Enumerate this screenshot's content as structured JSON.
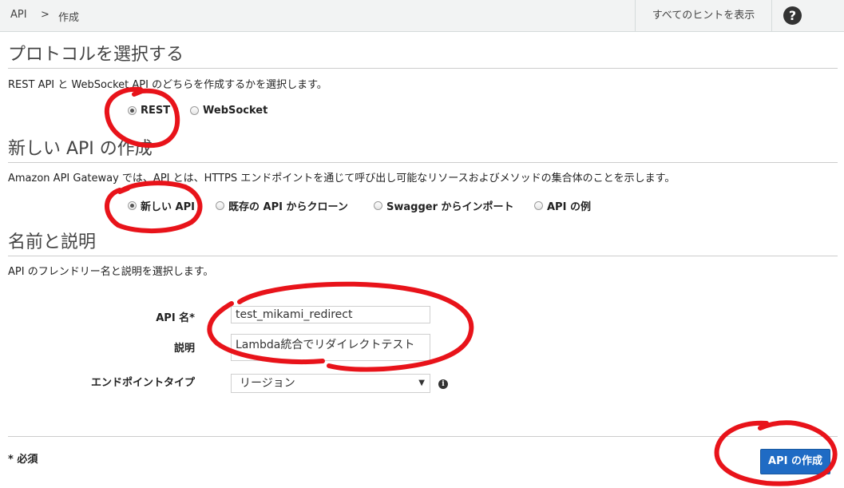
{
  "breadcrumb": {
    "root": "API",
    "separator": ">",
    "current": "作成"
  },
  "header": {
    "hints_label": "すべてのヒントを表示",
    "help_symbol": "?",
    "help_icon": "question-circle-icon"
  },
  "protocol": {
    "title": "プロトコルを選択する",
    "description": "REST API と WebSocket API のどちらを作成するかを選択します。",
    "options": [
      {
        "label": "REST",
        "selected": true
      },
      {
        "label": "WebSocket",
        "selected": false
      }
    ]
  },
  "new_api": {
    "title": "新しい API の作成",
    "description": "Amazon API Gateway では、API とは、HTTPS エンドポイントを通じて呼び出し可能なリソースおよびメソッドの集合体のことを示します。",
    "options": [
      {
        "label": "新しい API",
        "selected": true
      },
      {
        "label": "既存の API からクローン",
        "selected": false
      },
      {
        "label": "Swagger からインポート",
        "selected": false
      },
      {
        "label": "API の例",
        "selected": false
      }
    ]
  },
  "name_desc": {
    "title": "名前と説明",
    "description": "API のフレンドリー名と説明を選択します。",
    "api_name_label": "API 名*",
    "api_name_value": "test_mikami_redirect",
    "desc_label": "説明",
    "desc_value": "Lambda統合でリダイレクトテスト",
    "endpoint_label": "エンドポイントタイプ",
    "endpoint_value": "リージョン",
    "info_symbol": "i",
    "info_icon": "info-circle-icon",
    "caret_symbol": "▼"
  },
  "footer": {
    "required_note": "* 必須",
    "create_label": "API の作成"
  },
  "colors": {
    "annotation": "#e8131a",
    "primary_button": "#1f6bc4",
    "topbar_bg": "#f2f3f3"
  }
}
